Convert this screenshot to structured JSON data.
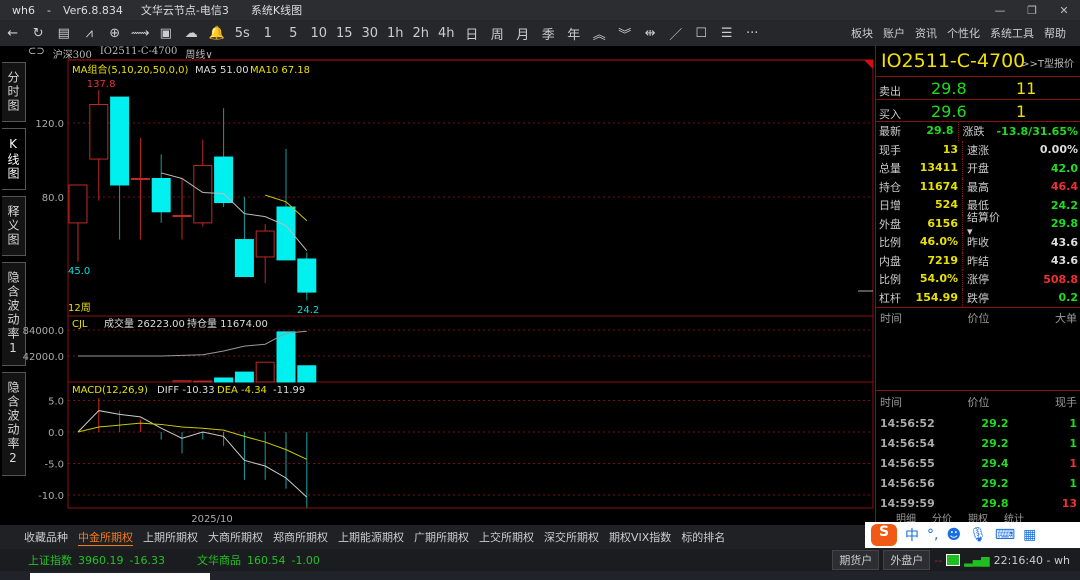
{
  "window": {
    "app": "wh6",
    "sep": "-",
    "version": "Ver6.8.834",
    "server": "文华云节点-电信3",
    "view": "系统K线图",
    "min": "—",
    "max": "❐",
    "close": "✕"
  },
  "toolbar": {
    "icons": [
      "←",
      "↻",
      "▤",
      "⩘",
      "⊕",
      "⟿",
      "▣",
      "☁",
      "🔔"
    ],
    "periods": [
      "5s",
      "1",
      "5",
      "10",
      "15",
      "30",
      "1h",
      "2h",
      "4h",
      "日",
      "周",
      "月",
      "季",
      "年"
    ],
    "tools": [
      "︽",
      "︾",
      "⇹",
      "／",
      "☐",
      "☰",
      "···"
    ],
    "menu": [
      "板块",
      "账户",
      "资讯",
      "个性化",
      "系统工具",
      "帮助"
    ]
  },
  "crumb": {
    "index": "沪深300",
    "contract": "IO2511-C-4700",
    "period": "周线"
  },
  "sidetabs": [
    "分时图",
    "K线图",
    "释义图",
    "隐含波动率1",
    "隐含波动率2"
  ],
  "main": {
    "ma_label": "MA组合(5,10,20,50,0,0)",
    "ma5": "MA5 51.00",
    "ma10": "MA10 67.18",
    "count": "12周",
    "high_label": "137.8",
    "low_label": "45.0",
    "last_low_label": "24.2",
    "vol_label": "CJL",
    "vol_text": "成交量 26223.00",
    "oi_text": "持仓量 11674.00",
    "macd_label": "MACD(12,26,9)",
    "diff": "DIFF -10.33",
    "dea": "DEA -4.34",
    "macd": "-11.99",
    "date": "2025/10"
  },
  "chart_data": {
    "type": "candlestick",
    "price_axis": {
      "ticks": [
        "120.0",
        "80.0"
      ],
      "values": [
        120,
        80
      ]
    },
    "candles": [
      [
        66,
        86.5,
        86.5,
        45
      ],
      [
        100.5,
        130,
        137.8,
        78
      ],
      [
        134,
        86.5,
        134,
        57
      ],
      [
        90,
        90,
        112,
        57
      ],
      [
        90,
        72,
        103,
        66
      ],
      [
        70,
        70,
        90,
        57
      ],
      [
        66,
        97,
        111,
        64
      ],
      [
        101.6,
        77,
        128,
        74.6
      ],
      [
        57,
        37,
        80,
        37
      ],
      [
        47.6,
        61.6,
        65.4,
        33.5
      ],
      [
        74.6,
        46,
        106,
        46
      ],
      [
        46.5,
        28.6,
        50,
        24.2
      ]
    ],
    "ma5": [
      null,
      null,
      null,
      null,
      93,
      90,
      82.4,
      81.8,
      71,
      69.4,
      64.5,
      51
    ],
    "ma10": [
      null,
      null,
      null,
      null,
      null,
      null,
      null,
      null,
      null,
      81,
      77.4,
      67.18
    ],
    "volume": {
      "ticks": [
        "84000.0",
        "42000.0"
      ],
      "values": [
        0,
        0,
        0,
        0,
        0,
        2000,
        1500,
        6500,
        16000,
        32000,
        81000,
        26223
      ],
      "oi": [
        42000,
        42000,
        42000,
        42000,
        42000,
        43000,
        44000,
        50000,
        58000,
        61000,
        79000,
        82000
      ]
    },
    "macd": {
      "ticks": [
        "5.0",
        "0.0",
        "-5.0",
        "-10.0"
      ],
      "diff": [
        0,
        3.4,
        2.8,
        2.4,
        0.6,
        -1.0,
        0,
        -0.7,
        -4.5,
        -5.4,
        -7.3,
        -10.33
      ],
      "dea": [
        0,
        0.8,
        1.1,
        1.4,
        1.2,
        0.8,
        0.6,
        0.3,
        -0.7,
        -1.6,
        -2.8,
        -4.34
      ],
      "hist": [
        0,
        5.4,
        3.4,
        2.0,
        -1.2,
        -3.4,
        -1.2,
        -2.2,
        -7.6,
        -7.6,
        -9.0,
        -11.99
      ]
    }
  },
  "quote": {
    "code": "IO2511-C-4700",
    "tlink": ">>T型报价",
    "sell_label": "卖出",
    "sell_price": "29.8",
    "sell_qty": "11",
    "buy_label": "买入",
    "buy_price": "29.6",
    "buy_qty": "1",
    "stats": [
      [
        "最新",
        "29.8",
        "g",
        "涨跌",
        "-13.8/31.65%",
        "g"
      ],
      [
        "现手",
        "13",
        "y",
        "速涨",
        "0.00%",
        "w"
      ],
      [
        "总量",
        "13411",
        "y",
        "开盘",
        "42.0",
        "g"
      ],
      [
        "持仓",
        "11674",
        "y",
        "最高",
        "46.4",
        "r"
      ],
      [
        "日增",
        "524",
        "y",
        "最低",
        "24.2",
        "g"
      ],
      [
        "外盘",
        "6156",
        "y",
        "结算价 ▾",
        "29.8",
        "g"
      ],
      [
        "比例",
        "46.0%",
        "y",
        "昨收",
        "43.6",
        "w"
      ],
      [
        "内盘",
        "7219",
        "y",
        "昨结",
        "43.6",
        "w"
      ],
      [
        "比例",
        "54.0%",
        "y",
        "涨停",
        "508.8",
        "r"
      ],
      [
        "杠杆",
        "154.99",
        "y",
        "跌停",
        "0.2",
        "g"
      ]
    ],
    "big_headers": [
      "时间",
      "价位",
      "大单"
    ],
    "tick_headers": [
      "时间",
      "价位",
      "现手"
    ],
    "ticks": [
      [
        "14:56:52",
        "29.2",
        "1",
        "g"
      ],
      [
        "14:56:54",
        "29.2",
        "1",
        "g"
      ],
      [
        "14:56:55",
        "29.4",
        "1",
        "r"
      ],
      [
        "14:56:56",
        "29.2",
        "1",
        "g"
      ],
      [
        "14:59:59",
        "29.8",
        "13",
        "r"
      ]
    ],
    "tabs": [
      "明细",
      "分价",
      "期权",
      "统计"
    ]
  },
  "bottom_tabs": [
    "收藏品种",
    "中金所期权",
    "上期所期权",
    "大商所期权",
    "郑商所期权",
    "上期能源期权",
    "广期所期权",
    "上交所期权",
    "深交所期权",
    "期权VIX指数",
    "标的排名"
  ],
  "status": {
    "idx1": "上证指数",
    "idx1_val": "3960.19",
    "idx1_chg": "-16.33",
    "idx2": "文华商品",
    "idx2_val": "160.54",
    "idx2_chg": "-1.00",
    "btn1": "期货户",
    "btn2": "外盘户",
    "time": "22:16:40 - wh"
  },
  "ime": {
    "logo": "S",
    "lang": "中",
    "punct": "°,"
  }
}
